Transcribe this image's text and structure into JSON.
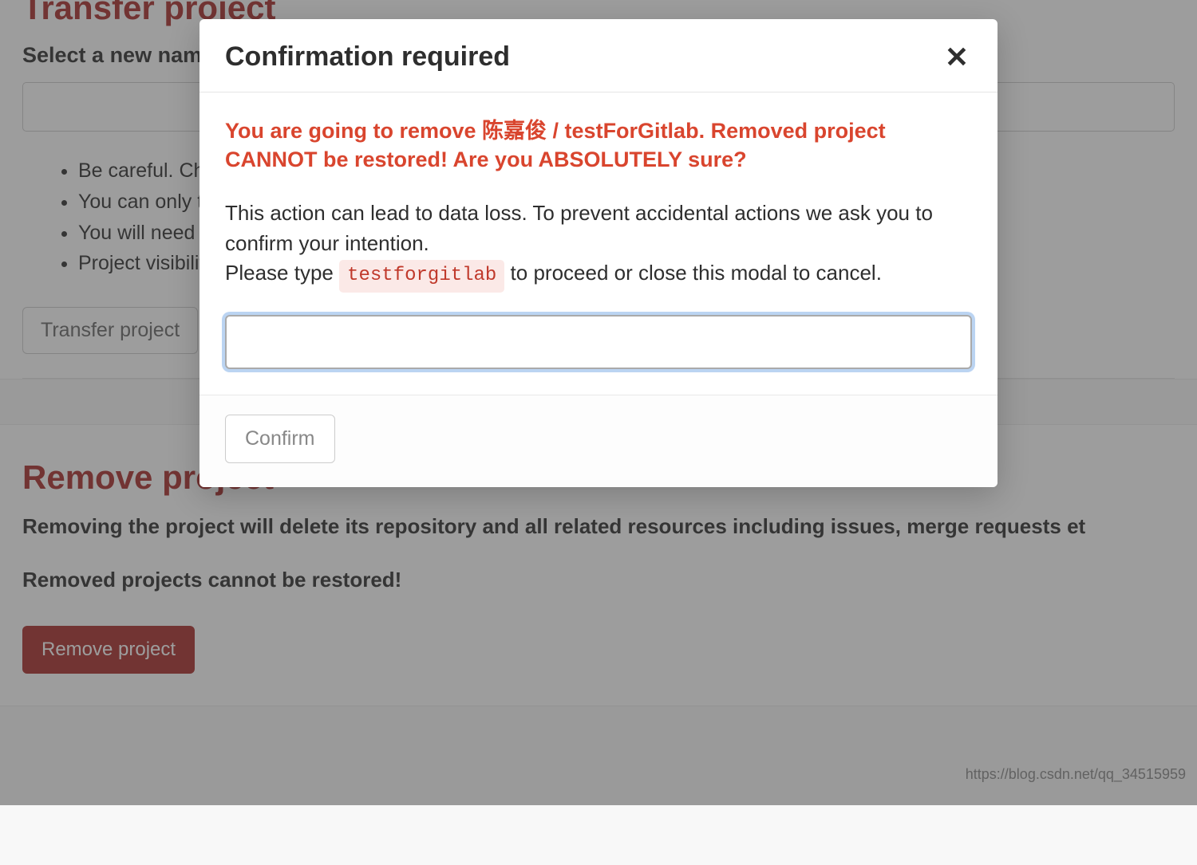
{
  "transfer": {
    "title": "Transfer project",
    "subtitle": "Select a new namespace",
    "warnings": [
      "Be careful. Changing th",
      "You can only transfer th",
      "You will need to update",
      "Project visibility level w"
    ],
    "button": "Transfer project"
  },
  "remove": {
    "title": "Remove project",
    "desc1": "Removing the project will delete its repository and all related resources including issues, merge requests et",
    "desc2": "Removed projects cannot be restored!",
    "button": "Remove project"
  },
  "modal": {
    "title": "Confirmation required",
    "warning": "You are going to remove 陈嘉俊 / testForGitlab. Removed project CANNOT be restored! Are you ABSOLUTELY sure?",
    "body1": "This action can lead to data loss. To prevent accidental actions we ask you to confirm your intention.",
    "body2_pre": "Please type ",
    "code": "testforgitlab",
    "body2_post": " to proceed or close this modal to cancel.",
    "confirm": "Confirm",
    "input_value": ""
  },
  "footer": {
    "url": "https://blog.csdn.net/qq_34515959"
  }
}
